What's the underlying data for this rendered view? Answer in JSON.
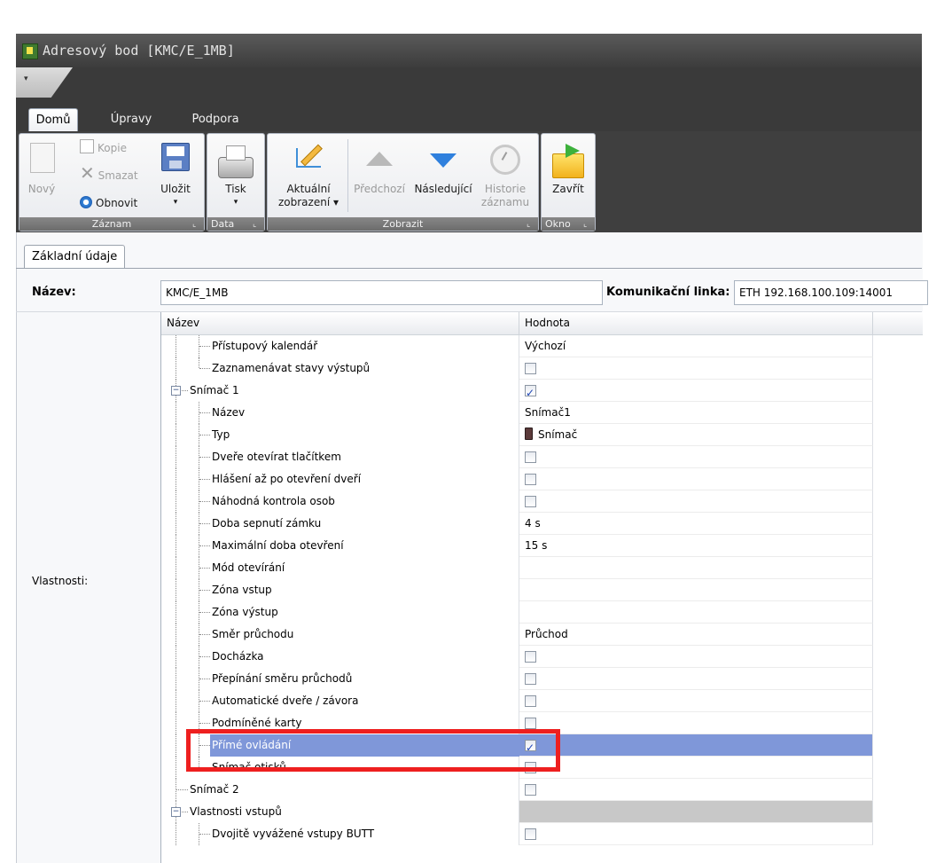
{
  "window": {
    "title": "Adresový bod [KMC/E_1MB]",
    "qat_label": "▾"
  },
  "tabs": [
    "Domů",
    "Úpravy",
    "Podpora"
  ],
  "ribbon": {
    "zaznam": {
      "label": "Záznam",
      "new": "Nový",
      "copy": "Kopie",
      "delete": "Smazat",
      "refresh": "Obnovit",
      "save": "Uložit",
      "save_arrow": "▾"
    },
    "data": {
      "label": "Data",
      "print": "Tisk",
      "print_arrow": "▾"
    },
    "zobrazit": {
      "label": "Zobrazit",
      "current_1": "Aktuální",
      "current_2": "zobrazení ▾",
      "previous": "Předchozí",
      "next": "Následující",
      "history_1": "Historie",
      "history_2": "záznamu"
    },
    "okno": {
      "label": "Okno",
      "close": "Zavřít"
    },
    "launcher_glyph": "⌞"
  },
  "form": {
    "tab": "Základní údaje",
    "name_label": "Název:",
    "name_value": "KMC/E_1MB",
    "link_label": "Komunikační linka:",
    "link_value": "ETH 192.168.100.109:14001",
    "props_label": "Vlastnosti:"
  },
  "grid": {
    "headers": {
      "name": "Název",
      "value": "Hodnota"
    },
    "rows": [
      {
        "name": "Přístupový kalendář",
        "value": "Výchozí"
      },
      {
        "name": "Zaznamenávat stavy výstupů",
        "value": ""
      },
      {
        "name": "Snímač 1",
        "value": ""
      },
      {
        "name": "Název",
        "value": "Snímač1"
      },
      {
        "name": "Typ",
        "value": "Snímač"
      },
      {
        "name": "Dveře otevírat tlačítkem",
        "value": ""
      },
      {
        "name": "Hlášení až po otevření dveří",
        "value": ""
      },
      {
        "name": "Náhodná kontrola osob",
        "value": ""
      },
      {
        "name": "Doba sepnutí zámku",
        "value": "4 s"
      },
      {
        "name": "Maximální doba otevření",
        "value": "15 s"
      },
      {
        "name": "Mód otevírání",
        "value": ""
      },
      {
        "name": "Zóna vstup",
        "value": ""
      },
      {
        "name": "Zóna výstup",
        "value": ""
      },
      {
        "name": "Směr průchodu",
        "value": "Průchod"
      },
      {
        "name": "Docházka",
        "value": ""
      },
      {
        "name": "Přepínání směru průchodů",
        "value": ""
      },
      {
        "name": "Automatické dveře / závora",
        "value": ""
      },
      {
        "name": "Podmíněné karty",
        "value": ""
      },
      {
        "name": "Přímé ovládání",
        "value": ""
      },
      {
        "name": "Snímač otisků",
        "value": ""
      },
      {
        "name": "Snímač 2",
        "value": ""
      },
      {
        "name": "Vlastnosti vstupů",
        "value": ""
      },
      {
        "name": "Dvojitě vyvážené vstupy BUTT",
        "value": ""
      }
    ],
    "expander_minus": "−",
    "colors": {
      "selected": "#7f97d9",
      "highlight": "#ee1f1f"
    }
  }
}
